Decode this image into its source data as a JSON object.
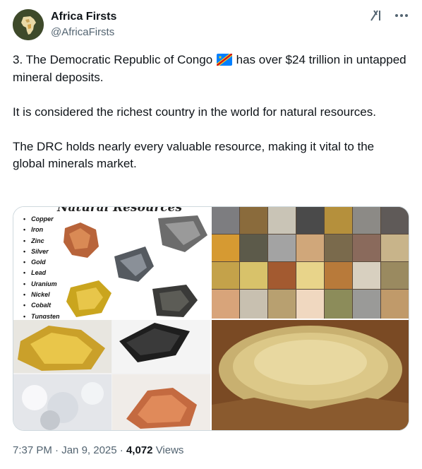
{
  "author": {
    "display_name": "Africa Firsts",
    "handle": "@AfricaFirsts",
    "avatar_icon": "africa-map-avatar"
  },
  "top_icons": [
    "grok-icon",
    "more-icon"
  ],
  "tweet": {
    "line1_before_flag": "3. The Democratic Republic of Congo ",
    "flag_icon": "drc-flag-icon",
    "line1_after_flag": " has over $24 trillion in untapped mineral deposits.",
    "paragraph2": "It is considered the richest country in the world for natural resources.",
    "paragraph3": "The DRC holds nearly every valuable resource, making it vital to the global minerals market."
  },
  "media": {
    "natural_resources_title": "Natural Resources",
    "minerals": [
      "Copper",
      "Iron",
      "Zinc",
      "Silver",
      "Gold",
      "Lead",
      "Uranium",
      "Nickel",
      "Cobalt",
      "Tungsten"
    ]
  },
  "footer": {
    "time": "7:37 PM",
    "separator": "·",
    "date": "Jan 9, 2025",
    "views_count": "4,072",
    "views_label": "Views"
  },
  "colors": {
    "text": "#0f1419",
    "secondary": "#536471",
    "border": "#cfd9de"
  }
}
